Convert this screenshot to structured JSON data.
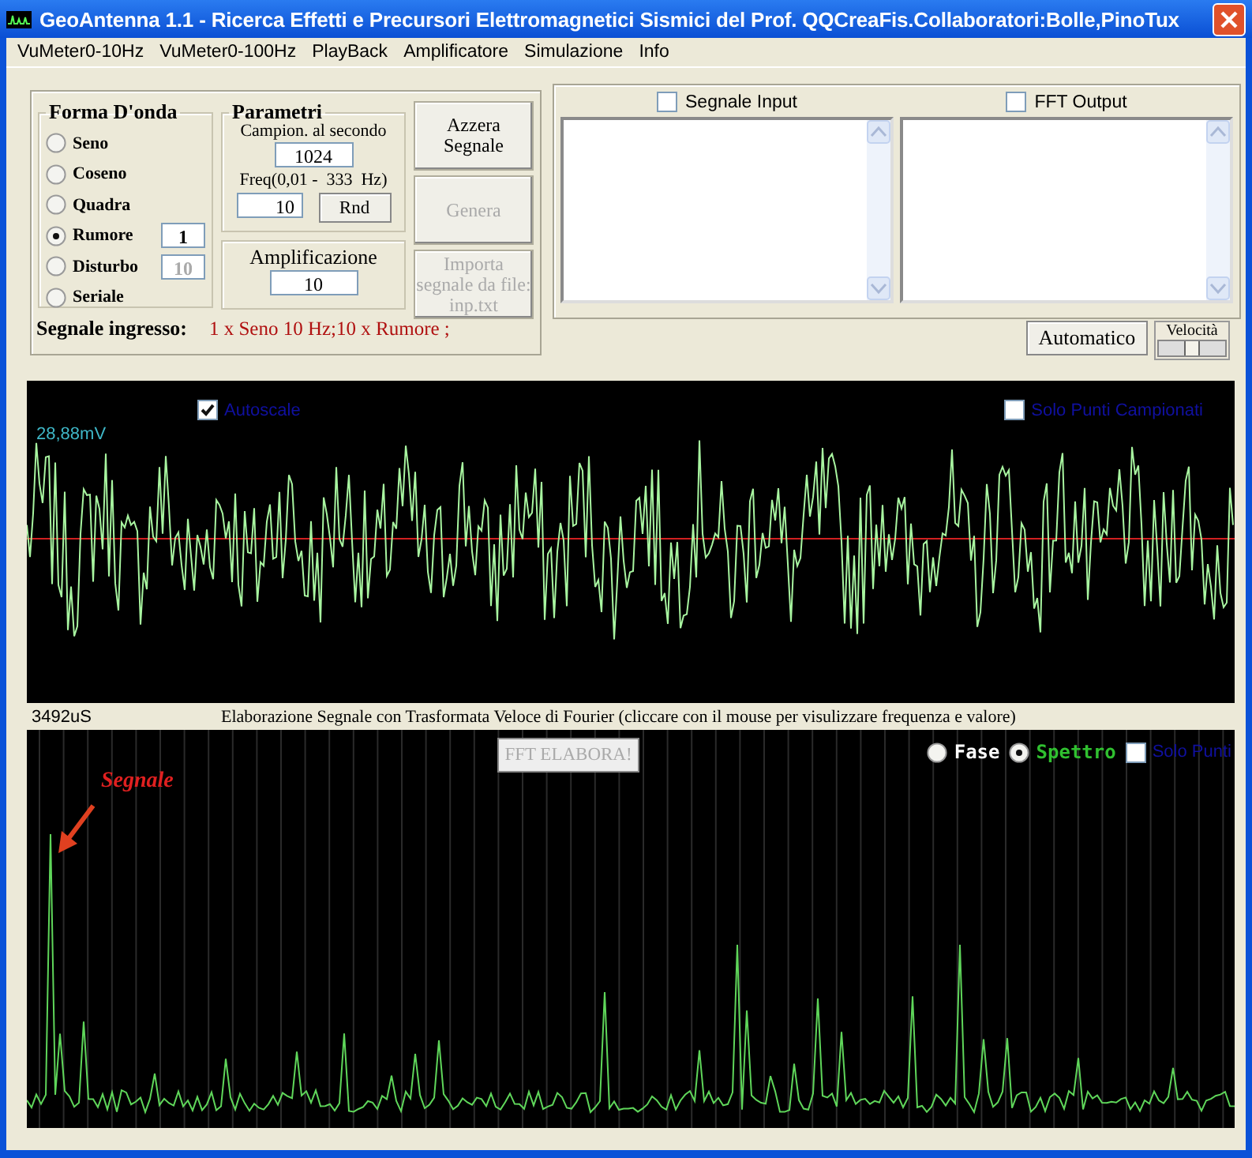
{
  "window": {
    "title": "GeoAntenna 1.1 - Ricerca Effetti e Precursori Elettromagnetici Sismici del Prof. QQCreaFis.Collaboratori:Bolle,PinoTux"
  },
  "menu": [
    "VuMeter0-10Hz",
    "VuMeter0-100Hz",
    "PlayBack",
    "Amplificatore",
    "Simulazione",
    "Info"
  ],
  "waveform": {
    "title": "Forma D'onda",
    "options": [
      {
        "label": "Seno",
        "selected": false
      },
      {
        "label": "Coseno",
        "selected": false
      },
      {
        "label": "Quadra",
        "selected": false
      },
      {
        "label": "Rumore",
        "selected": true,
        "field": {
          "value": "1",
          "disabled": false
        }
      },
      {
        "label": "Disturbo",
        "selected": false,
        "field": {
          "value": "10",
          "disabled": true
        }
      },
      {
        "label": "Seriale",
        "selected": false
      }
    ]
  },
  "parameters": {
    "title": "Parametri",
    "sample_rate_label": "Campion. al secondo",
    "sample_rate": "1024",
    "frequency_label": "Freq(0,01 -  333  Hz)",
    "frequency": "10",
    "random_button": "Rnd"
  },
  "amplification": {
    "title": "Amplificazione",
    "value": "10"
  },
  "actions": [
    {
      "label": "Azzera Segnale",
      "disabled": false
    },
    {
      "label": "Genera",
      "disabled": true
    },
    {
      "label": "Importa segnale da file: inp.txt",
      "disabled": true
    }
  ],
  "input_signal": {
    "label": "Segnale ingresso:",
    "value": "1 x Seno 10 Hz;10 x Rumore ;"
  },
  "outputs": [
    {
      "label": "Segnale Input",
      "checked": false
    },
    {
      "label": "FFT Output",
      "checked": false
    }
  ],
  "automatic_button": "Automatico",
  "speed": {
    "label": "Velocità",
    "level": 0.5
  },
  "scope": {
    "autoscale": {
      "label": "Autoscale",
      "checked": true
    },
    "sampled_points": {
      "label": "Solo Punti Campionati",
      "checked": false
    },
    "scale": "28,88mV"
  },
  "time": "3492uS",
  "caption": "Elaborazione Segnale con Trasformata Veloce di Fourier (cliccare con il mouse per visulizzare frequenza e valore)",
  "spectrum": {
    "button": "FFT ELABORA!",
    "modes": [
      {
        "label": "Fase",
        "selected": false
      },
      {
        "label": "Spettro",
        "selected": true
      }
    ],
    "points_only": {
      "label": "Solo Punti",
      "checked": false
    },
    "annotation": "Segnale"
  }
}
